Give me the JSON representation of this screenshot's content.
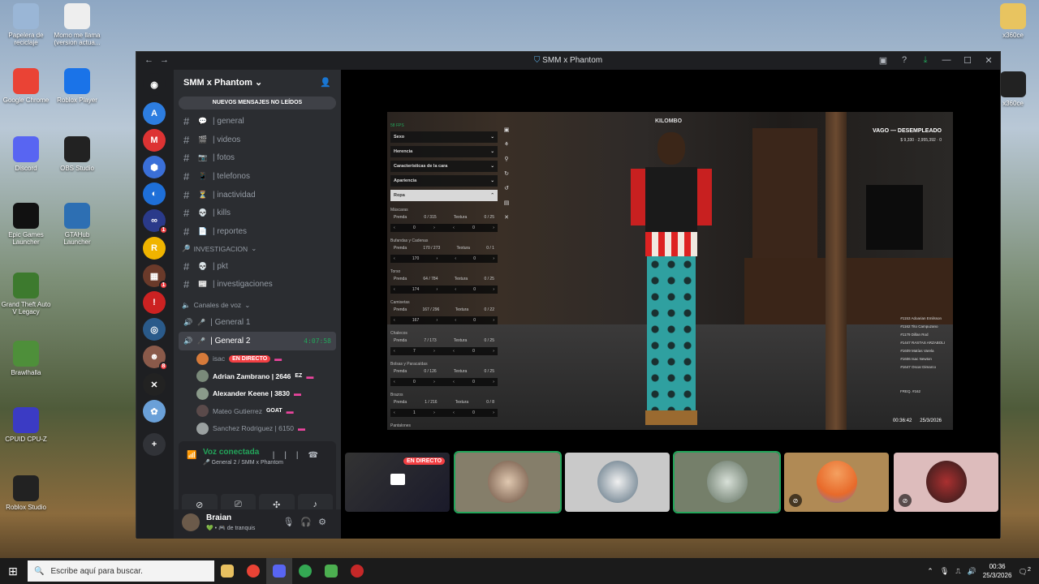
{
  "desktop": {
    "icons_left": [
      {
        "label": "Papelera de reciclaje",
        "icon": "recycle-bin-icon",
        "color": "#9ab6d6"
      },
      {
        "label": "Momo me llama (version actua...",
        "icon": "video-file-icon",
        "color": "#eeeeee"
      },
      {
        "label": "Google Chrome",
        "icon": "chrome-icon",
        "color": "#ea4335"
      },
      {
        "label": "Roblox Player",
        "icon": "roblox-icon",
        "color": "#1a73e8"
      },
      {
        "label": "Discord",
        "icon": "discord-icon",
        "color": "#5865f2"
      },
      {
        "label": "OBS Studio",
        "icon": "obs-icon",
        "color": "#222222"
      },
      {
        "label": "Epic Games Launcher",
        "icon": "epic-icon",
        "color": "#111111"
      },
      {
        "label": "GTAHub Launcher",
        "icon": "gtahub-icon",
        "color": "#2d6fb3"
      },
      {
        "label": "Grand Theft Auto V Legacy",
        "icon": "gta-icon",
        "color": "#3d7a2e"
      },
      {
        "label": "Brawlhalla",
        "icon": "brawlhalla-icon",
        "color": "#4e8f3a"
      },
      {
        "label": "CPUID CPU-Z",
        "icon": "cpuz-icon",
        "color": "#3b3bc4"
      },
      {
        "label": "Roblox Studio",
        "icon": "roblox-studio-icon",
        "color": "#222222"
      }
    ],
    "icons_right": [
      {
        "label": "x360ce",
        "icon": "folder-icon",
        "color": "#e8c460"
      },
      {
        "label": "x360ce",
        "icon": "x360ce-icon",
        "color": "#222222"
      }
    ]
  },
  "window": {
    "title": "SMM x Phantom",
    "nav": [
      "←",
      "→"
    ],
    "controls": [
      "▣",
      "?",
      "⤓",
      "—",
      "☐",
      "✕"
    ]
  },
  "rail": {
    "servers": [
      {
        "name": "discord-home",
        "glyph": "◉",
        "color": "#1e1f22",
        "badge": ""
      },
      {
        "name": "server-a",
        "glyph": "A",
        "color": "#2d7de0",
        "badge": ""
      },
      {
        "name": "server-mario",
        "glyph": "M",
        "color": "#d33",
        "badge": ""
      },
      {
        "name": "server-cube",
        "glyph": "⬢",
        "color": "#3a6fd8",
        "badge": ""
      },
      {
        "name": "server-swirl",
        "glyph": "◐",
        "color": "#1e6fd8",
        "badge": ""
      },
      {
        "name": "server-glasses",
        "glyph": "∞",
        "color": "#2a3a8a",
        "badge": "1"
      },
      {
        "name": "server-rockstar",
        "glyph": "R",
        "color": "#f0b400",
        "badge": ""
      },
      {
        "name": "server-photo",
        "glyph": "▦",
        "color": "#6a3a2a",
        "badge": "1"
      },
      {
        "name": "server-red",
        "glyph": "!",
        "color": "#c22",
        "badge": ""
      },
      {
        "name": "server-phantom",
        "glyph": "◎",
        "color": "#2a5a8a",
        "badge": ""
      },
      {
        "name": "server-face",
        "glyph": "☻",
        "color": "#8a5a4a",
        "badge": "8"
      },
      {
        "name": "server-x",
        "glyph": "✕",
        "color": "#222",
        "badge": ""
      },
      {
        "name": "server-anime",
        "glyph": "✿",
        "color": "#6aa0d8",
        "badge": ""
      },
      {
        "name": "add-server",
        "glyph": "+",
        "color": "#313338",
        "badge": ""
      }
    ]
  },
  "sidebar": {
    "server_name": "SMM x Phantom",
    "new_messages": "NUEVOS MENSAJES NO LEÍDOS",
    "text_channels": [
      {
        "emoji": "💬",
        "name": "| general"
      },
      {
        "emoji": "🎬",
        "name": "| videos"
      },
      {
        "emoji": "📷",
        "name": "| fotos"
      },
      {
        "emoji": "📱",
        "name": "| telefonos"
      },
      {
        "emoji": "⏳",
        "name": "| inactividad"
      },
      {
        "emoji": "💀",
        "name": "| kills"
      },
      {
        "emoji": "📄",
        "name": "| reportes"
      }
    ],
    "cat_investigacion": "INVESTIGACION",
    "invest_channels": [
      {
        "emoji": "💀",
        "name": "| pkt"
      },
      {
        "emoji": "📰",
        "name": "| investigaciones"
      }
    ],
    "cat_voice": "Canales de voz",
    "voice_channels": [
      {
        "name": "| General 1",
        "time": ""
      },
      {
        "name": "| General 2",
        "time": "4:07:58"
      }
    ],
    "voice_users": [
      {
        "name": "isac",
        "bold": false,
        "live": "EN DIRECTO",
        "tag": "",
        "avatar": "#d67a3a"
      },
      {
        "name": "Adrian Zambrano | 2646",
        "bold": true,
        "live": "",
        "tag": "EZ",
        "avatar": "#7a8a7a"
      },
      {
        "name": "Alexander Keene | 3830",
        "bold": true,
        "live": "",
        "tag": "",
        "avatar": "#8a9a8a"
      },
      {
        "name": "Mateo Gutierrez",
        "bold": false,
        "live": "",
        "tag": "GOAT",
        "avatar": "#5a4a4a"
      },
      {
        "name": "Sanchez Rodriguez | 6150",
        "bold": false,
        "live": "",
        "tag": "",
        "avatar": "#9aa0a0"
      }
    ],
    "voice_status": "Voz conectada",
    "voice_location": "General 2 / SMM x Phantom",
    "user_name": "Braian",
    "user_status": "de tranquis"
  },
  "game": {
    "fps": "58 FPS",
    "sections": [
      {
        "label": "Sexo",
        "selected": false
      },
      {
        "label": "Herencia",
        "selected": false
      },
      {
        "label": "Características de la cara",
        "selected": false
      },
      {
        "label": "Apariencia",
        "selected": false
      },
      {
        "label": "Ropa",
        "selected": true
      }
    ],
    "clothing": [
      {
        "label": "Máscaras",
        "prenda": "0 / 315",
        "textura": "0 / 25",
        "v1": "0",
        "v2": "0"
      },
      {
        "label": "Bufandas y Cadenas",
        "prenda": "170 / 273",
        "textura": "0 / 1",
        "v1": "170",
        "v2": "0"
      },
      {
        "label": "Torso",
        "prenda": "64 / 784",
        "textura": "0 / 25",
        "v1": "174",
        "v2": "0"
      },
      {
        "label": "Camisetas",
        "prenda": "167 / 296",
        "textura": "0 / 22",
        "v1": "167",
        "v2": "0"
      },
      {
        "label": "Chalecos",
        "prenda": "7 / 173",
        "textura": "0 / 25",
        "v1": "7",
        "v2": "0"
      },
      {
        "label": "Bolsas y Paracaídas",
        "prenda": "0 / 126",
        "textura": "0 / 25",
        "v1": "0",
        "v2": "0"
      },
      {
        "label": "Brazos",
        "prenda": "1 / 216",
        "textura": "0 / 8",
        "v1": "1",
        "v2": "0"
      },
      {
        "label": "Pantalones",
        "prenda": "",
        "textura": "",
        "v1": "",
        "v2": ""
      }
    ],
    "prenda_label": "Prenda",
    "textura_label": "Textura",
    "logo": "KILOMBO",
    "job": "VAGO — DESEMPLEADO",
    "money": [
      "$ 9,330",
      "2,955,392",
      "0"
    ],
    "players": [
      "#1153 Adoarian Emilsson",
      "#1162 Tito Campuzano",
      "#1179 Dillan Rod",
      "#1447 RASTAS ARZABOLI",
      "#1609 Matías Varela",
      "#1606 Isac Newton",
      "#1647 Oscar Dimarco"
    ],
    "freq": "FREQ. #162",
    "time": "00:36:42",
    "date": "25/3/2026"
  },
  "tiles": {
    "live_label": "EN DIRECTO"
  },
  "taskbar": {
    "search_placeholder": "Escribe aquí para buscar.",
    "time": "00:36",
    "date": "25/3/2026",
    "notif_count": "2"
  }
}
